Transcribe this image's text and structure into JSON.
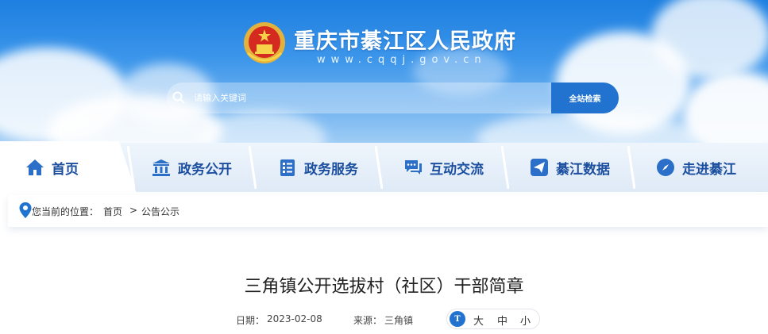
{
  "header": {
    "site_title": "重庆市綦江区人民政府",
    "site_domain": "www.cqqj.gov.cn",
    "emblem_icon": "national-emblem-icon"
  },
  "search": {
    "placeholder": "请输入关键词",
    "button_label": "全站检索"
  },
  "nav": {
    "items": [
      {
        "label": "首页",
        "icon": "home-icon"
      },
      {
        "label": "政务公开",
        "icon": "government-building-icon"
      },
      {
        "label": "政务服务",
        "icon": "service-list-icon"
      },
      {
        "label": "互动交流",
        "icon": "chat-bubble-icon"
      },
      {
        "label": "綦江数据",
        "icon": "send-plane-icon"
      },
      {
        "label": "走进綦江",
        "icon": "compass-icon"
      }
    ],
    "color": "#1c4f9f"
  },
  "breadcrumb": {
    "prefix": "您当前的位置：",
    "items": [
      "首页",
      "公告公示"
    ],
    "separator": ">"
  },
  "article": {
    "title": "三角镇公开选拔村（社区）干部简章",
    "date_label": "日期：",
    "date": "2023-02-08",
    "source_label": "来源：",
    "source": "三角镇",
    "font_sizes": [
      "大",
      "中",
      "小"
    ]
  },
  "colors": {
    "accent": "#2273cf",
    "sky_top": "#1d7fe0"
  }
}
